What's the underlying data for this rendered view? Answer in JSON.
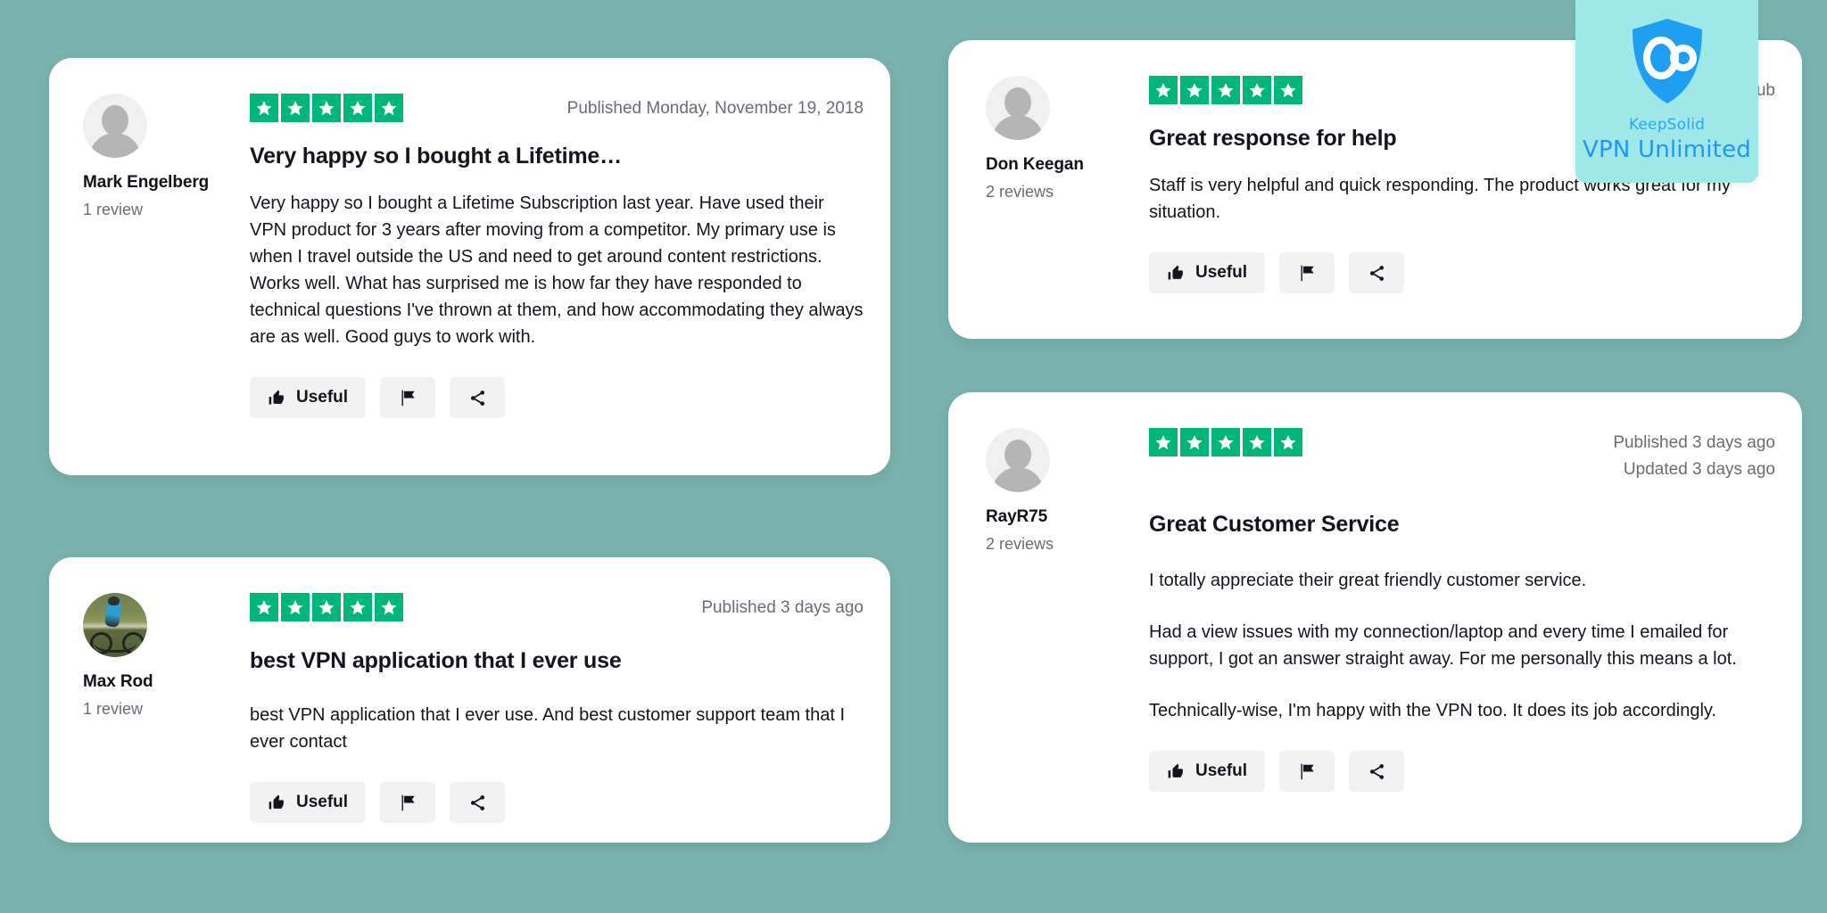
{
  "page": {
    "background_color": "#7bb3b0",
    "star_color": "#00b67a"
  },
  "badge": {
    "brand_sub": "KeepSolid",
    "brand_main": "VPN Unlimited",
    "background_color": "#9fe8e8",
    "logo_color": "#1e9ff2"
  },
  "buttons": {
    "useful_label": "Useful"
  },
  "reviews": [
    {
      "id": "mark-engelberg",
      "author": "Mark Engelberg",
      "reviews_count": "1 review",
      "avatar": "generic-avatar",
      "rating": 5,
      "published": "Published Monday, November 19, 2018",
      "updated": "",
      "title": "Very happy so I bought a Lifetime…",
      "paragraphs": [
        "Very happy so I bought a Lifetime Subscription last year. Have used their VPN product for 3 years after moving from a competitor. My primary use is when I travel outside the US and need to get around content restrictions. Works well. What has surprised me is how far they have responded to technical questions I've thrown at them, and how accommodating they always are as well. Good guys to work with."
      ]
    },
    {
      "id": "max-rod",
      "author": "Max Rod",
      "reviews_count": "1 review",
      "avatar": "photo-avatar-cyclist",
      "rating": 5,
      "published": "Published 3 days ago",
      "updated": "",
      "title": "best VPN application that I ever use",
      "paragraphs": [
        "best VPN application that I ever use. And best customer support team that I ever contact"
      ]
    },
    {
      "id": "don-keegan",
      "author": "Don Keegan",
      "reviews_count": "2 reviews",
      "avatar": "generic-avatar",
      "rating": 5,
      "published": "Pub",
      "updated": "",
      "title": "Great response for help",
      "paragraphs": [
        "Staff is very helpful and quick responding. The product works great for my situation."
      ]
    },
    {
      "id": "rayr75",
      "author": "RayR75",
      "reviews_count": "2 reviews",
      "avatar": "generic-avatar",
      "rating": 5,
      "published": "Published 3 days ago",
      "updated": "Updated 3 days ago",
      "title": "Great Customer Service",
      "paragraphs": [
        "I totally appreciate their great friendly customer service.",
        "Had a view issues with my connection/laptop and every time I emailed for support, I got an answer straight away. For me personally this means a lot.",
        "Technically-wise, I'm happy with the VPN too. It does its job accordingly."
      ]
    }
  ]
}
